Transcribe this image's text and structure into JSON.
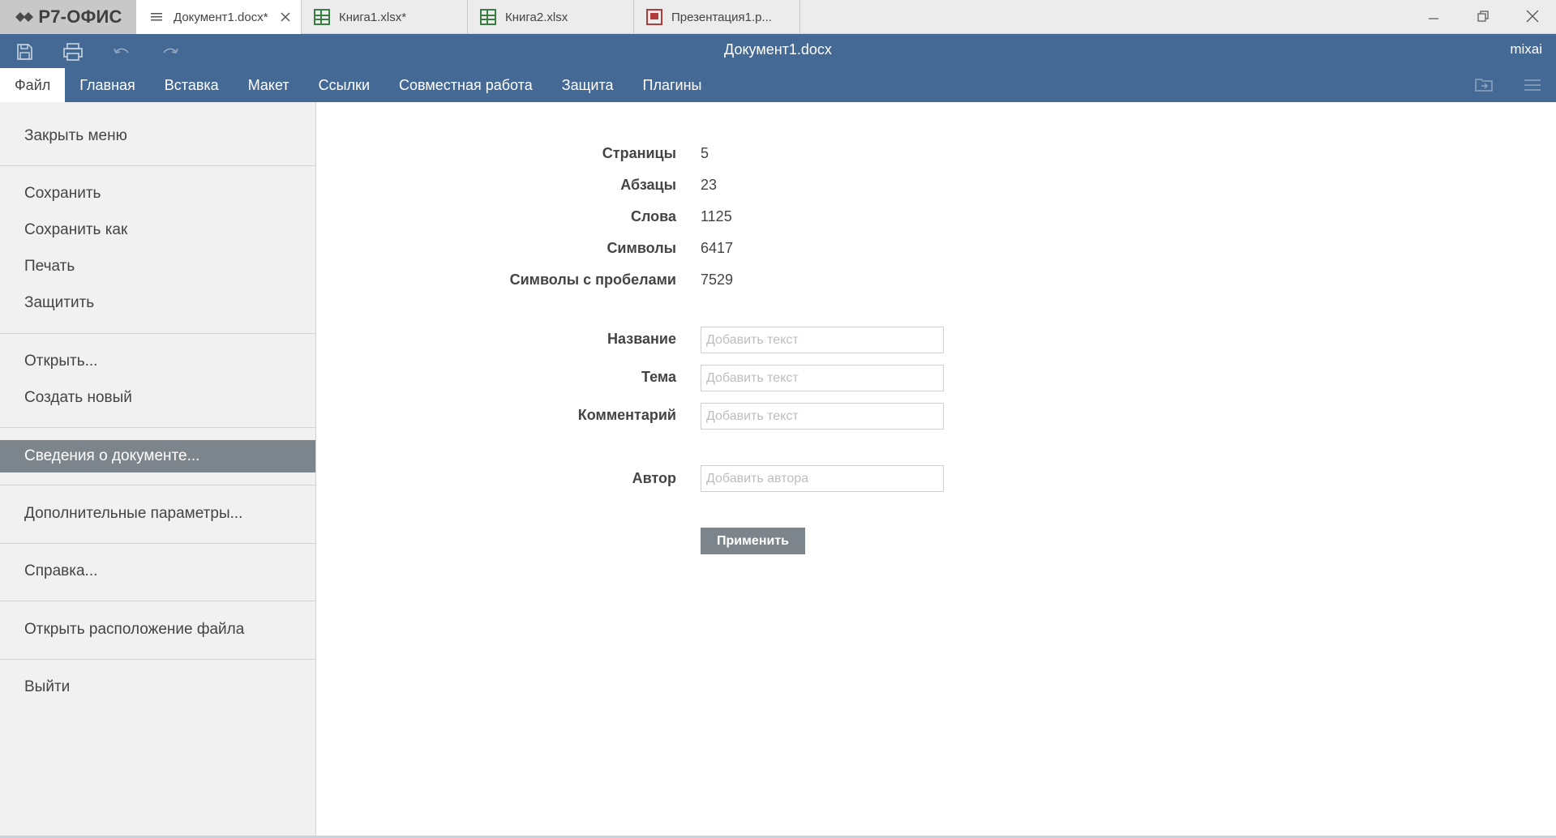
{
  "app": {
    "brand": "Р7-ОФИС",
    "tabs": [
      {
        "label": "Документ1.docx*",
        "icon": "document-icon",
        "active": true
      },
      {
        "label": "Книга1.xlsx*",
        "icon": "spreadsheet-icon",
        "active": false
      },
      {
        "label": "Книга2.xlsx",
        "icon": "spreadsheet-icon",
        "active": false
      },
      {
        "label": "Презентация1.р...",
        "icon": "presentation-icon",
        "active": false
      }
    ]
  },
  "header": {
    "title": "Документ1.docx",
    "user": "mixai",
    "menu": [
      "Файл",
      "Главная",
      "Вставка",
      "Макет",
      "Ссылки",
      "Совместная работа",
      "Защита",
      "Плагины"
    ],
    "active_menu": "Файл"
  },
  "sidebar": {
    "items": [
      "Закрыть меню",
      "Сохранить",
      "Сохранить как",
      "Печать",
      "Защитить",
      "Открыть...",
      "Создать новый",
      "Сведения о документе...",
      "Дополнительные параметры...",
      "Справка...",
      "Открыть расположение файла",
      "Выйти"
    ],
    "selected": "Сведения о документе..."
  },
  "info": {
    "stats": [
      {
        "label": "Страницы",
        "value": "5"
      },
      {
        "label": "Абзацы",
        "value": "23"
      },
      {
        "label": "Слова",
        "value": "1125"
      },
      {
        "label": "Символы",
        "value": "6417"
      },
      {
        "label": "Символы с пробелами",
        "value": "7529"
      }
    ],
    "fields": [
      {
        "label": "Название",
        "value": "",
        "placeholder": "Добавить текст"
      },
      {
        "label": "Тема",
        "value": "",
        "placeholder": "Добавить текст"
      },
      {
        "label": "Комментарий",
        "value": "",
        "placeholder": "Добавить текст"
      },
      {
        "label": "Автор",
        "value": "",
        "placeholder": "Добавить автора"
      }
    ],
    "apply_label": "Применить"
  },
  "colors": {
    "header": "#446995",
    "selected_item": "#7d858c",
    "sidebar_bg": "#f1f1f1",
    "spreadsheet": "#3a7d44",
    "presentation": "#b23c3c"
  }
}
